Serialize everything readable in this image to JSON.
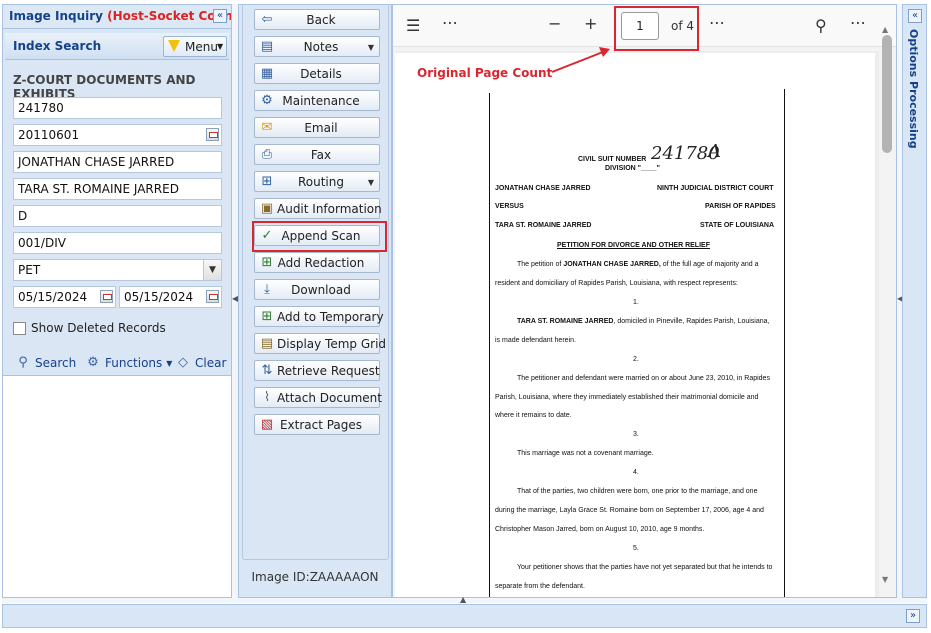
{
  "left_panel": {
    "title_main": "Image Inquiry",
    "title_status": "(Host-Socket Conn...",
    "index_search_label": "Index Search",
    "menu_label": "Menu",
    "form_heading": "Z-COURT DOCUMENTS AND EXHIBITS",
    "fields": {
      "suit_number": "241780",
      "date": "20110601",
      "party1": "JONATHAN CHASE JARRED",
      "party2": "TARA ST. ROMAINE JARRED",
      "code": "D",
      "division": "001/DIV",
      "doc_type": "PET",
      "date_from": "05/15/2024",
      "date_to": "05/15/2024"
    },
    "show_deleted_label": "Show Deleted Records",
    "tools": {
      "search": "Search",
      "functions": "Functions",
      "clear": "Clear"
    }
  },
  "actions": [
    {
      "label": "Back",
      "icon": "back-arrow-icon"
    },
    {
      "label": "Notes",
      "icon": "notes-icon",
      "dropdown": true
    },
    {
      "label": "Details",
      "icon": "details-icon"
    },
    {
      "label": "Maintenance",
      "icon": "gears-icon"
    },
    {
      "label": "Email",
      "icon": "envelope-icon"
    },
    {
      "label": "Fax",
      "icon": "fax-icon"
    },
    {
      "label": "Routing",
      "icon": "routing-icon",
      "dropdown": true
    },
    {
      "label": "Audit Information",
      "icon": "audit-icon"
    },
    {
      "label": "Append Scan",
      "icon": "check-circle-icon"
    },
    {
      "label": "Add Redaction",
      "icon": "add-icon"
    },
    {
      "label": "Download",
      "icon": "download-icon"
    },
    {
      "label": "Add to Temporary",
      "icon": "add-icon"
    },
    {
      "label": "Display Temp Grid",
      "icon": "temp-grid-icon"
    },
    {
      "label": "Retrieve Request",
      "icon": "retrieve-icon"
    },
    {
      "label": "Attach Document",
      "icon": "paperclip-icon"
    },
    {
      "label": "Extract Pages",
      "icon": "extract-icon"
    }
  ],
  "image_id": "Image ID:ZAAAAAON",
  "viewer": {
    "page_current": "1",
    "page_of": "of 4",
    "annotation": "Original Page Count"
  },
  "document": {
    "suit_label": "CIVIL SUIT NUMBER",
    "suit_hand": "241780",
    "suit_hand_suffix": "A",
    "division_label": "DIVISION \"____\"",
    "plaintiff": "JONATHAN CHASE JARRED",
    "court": "NINTH JUDICIAL DISTRICT COURT",
    "versus": "VERSUS",
    "parish": "PARISH OF RAPIDES",
    "defendant": "TARA ST. ROMAINE JARRED",
    "state": "STATE OF LOUISIANA",
    "petition_title": "PETITION FOR DIVORCE AND OTHER RELIEF",
    "p1_pre": "The petition of ",
    "p1_bold": "JONATHAN CHASE JARRED,",
    "p1_post": " of the full age of majority and a",
    "p1_line2": "resident and domiciliary of Rapides Parish, Louisiana, with respect represents:",
    "n1": "1.",
    "p2_bold": "TARA ST. ROMAINE JARRED",
    "p2_post": ", domiciled in Pineville, Rapides Parish, Louisiana,",
    "p2_line2": "is made defendant herein.",
    "n2": "2.",
    "p3_line1": "The petitioner and defendant were married on or about June 23, 2010, in Rapides",
    "p3_line2": "Parish, Louisiana, where they immediately established their matrimonial domicile and",
    "p3_line3": "where it remains to date.",
    "n3": "3.",
    "p4": "This marriage was not a covenant marriage.",
    "n4": "4.",
    "p5_line1": "That of the parties, two children were born, one prior to the marriage, and one",
    "p5_line2": "during the marriage, Layla Grace St. Romaine born on September 17, 2006, age 4 and",
    "p5_line3": "Christopher Mason Jarred, born on August 10, 2010, age 9 months.",
    "n5": "5.",
    "p6_line1": "Your petitioner shows that the parties have not yet separated but that he intends to",
    "p6_line2": "separate from the defendant."
  },
  "right_panel": {
    "title": "Options Processing"
  }
}
